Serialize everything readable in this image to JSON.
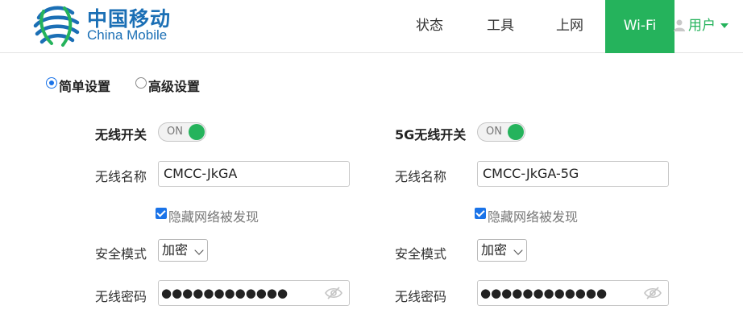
{
  "header": {
    "logo": {
      "cn": "中国移动",
      "en": "China Mobile"
    },
    "nav": {
      "status": "状态",
      "tools": "工具",
      "internet": "上网",
      "wifi": "Wi-Fi",
      "user": "用户"
    },
    "colors": {
      "accent": "#25b35c",
      "brand": "#1b6fb5"
    }
  },
  "mode": {
    "simple": "简单设置",
    "advanced": "高级设置",
    "selected": "simple"
  },
  "band24": {
    "switch_label": "无线开关",
    "switch_state": "ON",
    "ssid_label": "无线名称",
    "ssid_value": "CMCC-JkGA",
    "hide_label": "隐藏网络被发现",
    "hide_checked": true,
    "security_label": "安全模式",
    "security_value": "加密",
    "password_label": "无线密码",
    "password_masked": "●●●●●●●●●●●●"
  },
  "band5": {
    "switch_label": "5G无线开关",
    "switch_state": "ON",
    "ssid_label": "无线名称",
    "ssid_value": "CMCC-JkGA-5G",
    "hide_label": "隐藏网络被发现",
    "hide_checked": true,
    "security_label": "安全模式",
    "security_value": "加密",
    "password_label": "无线密码",
    "password_masked": "●●●●●●●●●●●●"
  },
  "icons": {
    "logo": "china-mobile-logo-icon",
    "user": "user-icon",
    "caret": "caret-down-icon",
    "eye": "eye-off-icon"
  }
}
